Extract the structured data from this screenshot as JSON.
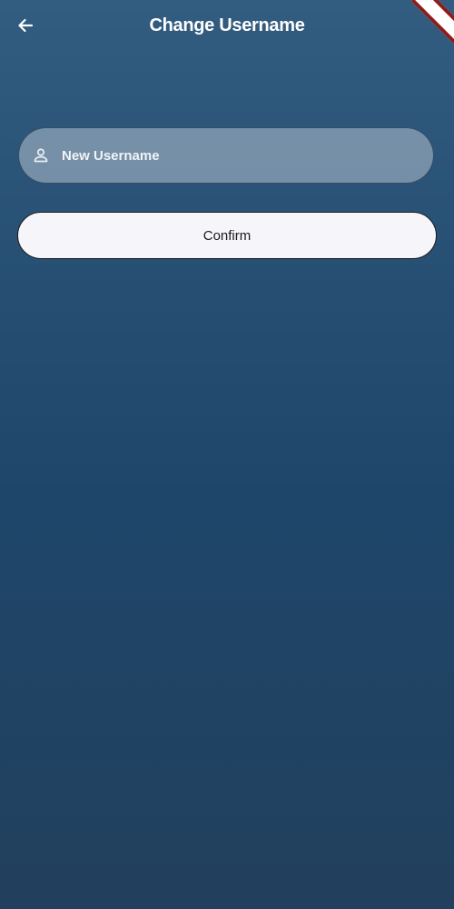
{
  "header": {
    "title": "Change Username",
    "back_icon": "arrow-left-icon"
  },
  "form": {
    "username_placeholder": "New Username",
    "username_value": "",
    "field_icon": "person-icon",
    "confirm_label": "Confirm"
  },
  "colors": {
    "background_top": "#325c80",
    "background_bottom": "#22405d",
    "button_background": "#f6f5fa",
    "debug_banner": "#8b1d1d"
  }
}
